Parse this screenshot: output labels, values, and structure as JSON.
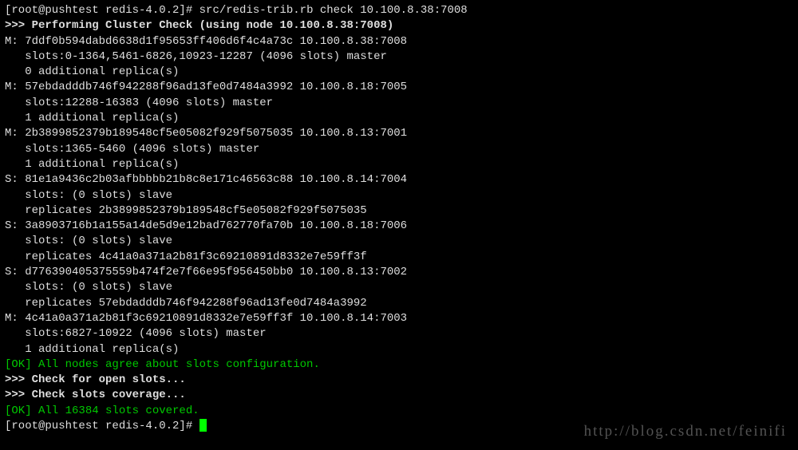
{
  "prompt1": "[root@pushtest redis-4.0.2]# ",
  "command": "src/redis-trib.rb check 10.100.8.38:7008",
  "header": ">>> Performing Cluster Check (using node 10.100.8.38:7008)",
  "nodes": [
    "M: 7ddf0b594dabd6638d1f95653ff406d6f4c4a73c 10.100.8.38:7008",
    "   slots:0-1364,5461-6826,10923-12287 (4096 slots) master",
    "   0 additional replica(s)",
    "M: 57ebdadddb746f942288f96ad13fe0d7484a3992 10.100.8.18:7005",
    "   slots:12288-16383 (4096 slots) master",
    "   1 additional replica(s)",
    "M: 2b3899852379b189548cf5e05082f929f5075035 10.100.8.13:7001",
    "   slots:1365-5460 (4096 slots) master",
    "   1 additional replica(s)",
    "S: 81e1a9436c2b03afbbbbb21b8c8e171c46563c88 10.100.8.14:7004",
    "   slots: (0 slots) slave",
    "   replicates 2b3899852379b189548cf5e05082f929f5075035",
    "S: 3a8903716b1a155a14de5d9e12bad762770fa70b 10.100.8.18:7006",
    "   slots: (0 slots) slave",
    "   replicates 4c41a0a371a2b81f3c69210891d8332e7e59ff3f",
    "S: d776390405375559b474f2e7f66e95f956450bb0 10.100.8.13:7002",
    "   slots: (0 slots) slave",
    "   replicates 57ebdadddb746f942288f96ad13fe0d7484a3992",
    "M: 4c41a0a371a2b81f3c69210891d8332e7e59ff3f 10.100.8.14:7003",
    "   slots:6827-10922 (4096 slots) master",
    "   1 additional replica(s)"
  ],
  "ok1": "[OK] All nodes agree about slots configuration.",
  "check1": ">>> Check for open slots...",
  "check2": ">>> Check slots coverage...",
  "ok2": "[OK] All 16384 slots covered.",
  "prompt2": "[root@pushtest redis-4.0.2]# ",
  "watermark": "http://blog.csdn.net/feinifi"
}
